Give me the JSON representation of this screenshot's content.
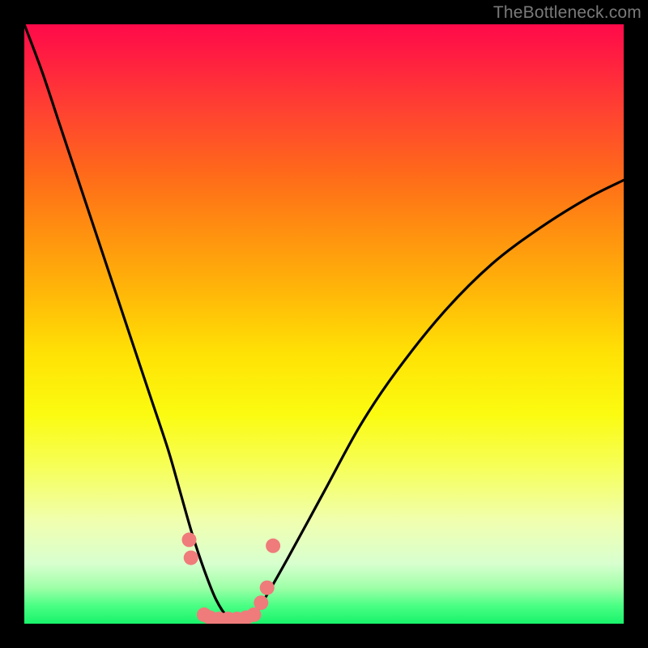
{
  "watermark": "TheBottleneck.com",
  "chart_data": {
    "type": "line",
    "title": "",
    "xlabel": "",
    "ylabel": "",
    "xlim": [
      0,
      100
    ],
    "ylim": [
      0,
      100
    ],
    "background_gradient": {
      "direction": "vertical",
      "stops": [
        {
          "pos": 0,
          "color": "#ff0a4a"
        },
        {
          "pos": 25,
          "color": "#ff6a1a"
        },
        {
          "pos": 55,
          "color": "#ffe205"
        },
        {
          "pos": 83,
          "color": "#f0ffb0"
        },
        {
          "pos": 100,
          "color": "#18f36a"
        }
      ]
    },
    "series": [
      {
        "name": "bottleneck-curve",
        "color": "#000000",
        "x": [
          0,
          3,
          6,
          9,
          12,
          15,
          18,
          21,
          24,
          26,
          28,
          30,
          32,
          34,
          36,
          38,
          40,
          44,
          50,
          56,
          62,
          70,
          78,
          86,
          94,
          100
        ],
        "y": [
          100,
          92,
          83,
          74,
          65,
          56,
          47,
          38,
          29,
          22,
          15,
          9,
          4,
          1,
          0,
          1,
          4,
          11,
          22,
          33,
          42,
          52,
          60,
          66,
          71,
          74
        ]
      },
      {
        "name": "highlight-dots",
        "type": "scatter",
        "color": "#ef7b7b",
        "points": [
          {
            "x": 27.5,
            "y": 14
          },
          {
            "x": 27.8,
            "y": 11
          },
          {
            "x": 30.0,
            "y": 1.5
          },
          {
            "x": 31.0,
            "y": 1.0
          },
          {
            "x": 32.5,
            "y": 0.8
          },
          {
            "x": 34.0,
            "y": 0.8
          },
          {
            "x": 35.5,
            "y": 0.8
          },
          {
            "x": 37.0,
            "y": 1.0
          },
          {
            "x": 38.3,
            "y": 1.5
          },
          {
            "x": 39.5,
            "y": 3.5
          },
          {
            "x": 40.5,
            "y": 6.0
          },
          {
            "x": 41.5,
            "y": 13.0
          }
        ]
      }
    ]
  }
}
